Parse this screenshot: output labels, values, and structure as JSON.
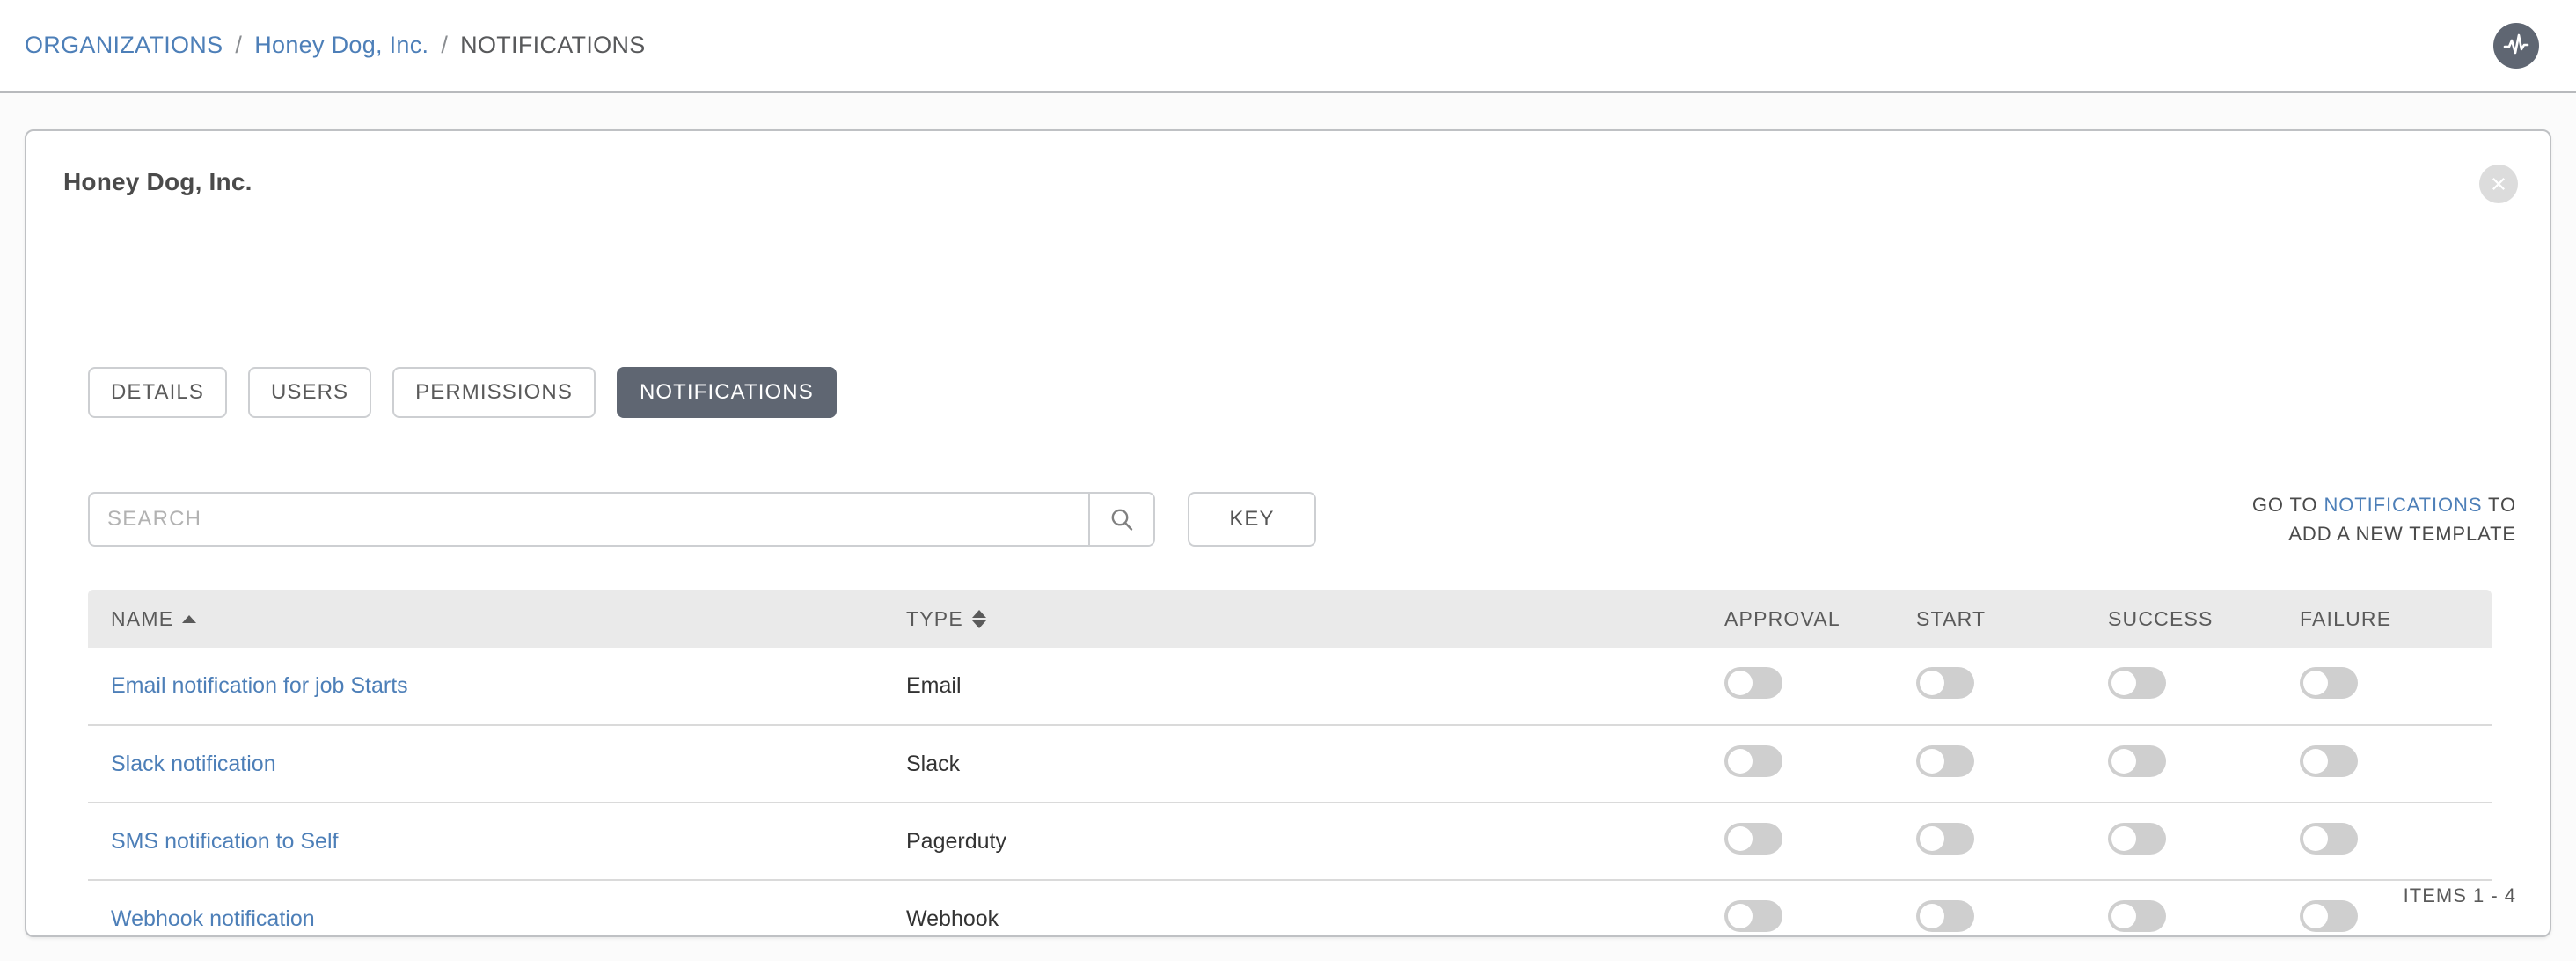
{
  "breadcrumb": {
    "organizations": "ORGANIZATIONS",
    "sep1": "/",
    "org": "Honey Dog, Inc.",
    "sep2": "/",
    "current": "NOTIFICATIONS",
    "activity_icon": "activity-stream-icon"
  },
  "card": {
    "title": "Honey Dog, Inc.",
    "close_icon": "close-circle-icon"
  },
  "tabs": [
    {
      "label": "DETAILS",
      "active": false
    },
    {
      "label": "USERS",
      "active": false
    },
    {
      "label": "PERMISSIONS",
      "active": false
    },
    {
      "label": "NOTIFICATIONS",
      "active": true
    }
  ],
  "search": {
    "placeholder": "SEARCH",
    "value": "",
    "icon": "search-icon"
  },
  "key_button": {
    "label": "KEY"
  },
  "hint": {
    "line1_prefix": "GO TO ",
    "link": "NOTIFICATIONS",
    "line1_suffix": " TO",
    "line2": "ADD A NEW TEMPLATE"
  },
  "table": {
    "columns": [
      {
        "label": "NAME",
        "sort": "asc"
      },
      {
        "label": "TYPE",
        "sort": "none"
      },
      {
        "label": "APPROVAL",
        "sort": null
      },
      {
        "label": "START",
        "sort": null
      },
      {
        "label": "SUCCESS",
        "sort": null
      },
      {
        "label": "FAILURE",
        "sort": null
      }
    ],
    "rows": [
      {
        "name": "Email notification for job Starts",
        "type": "Email",
        "approval": false,
        "start": false,
        "success": false,
        "failure": false
      },
      {
        "name": "Slack notification",
        "type": "Slack",
        "approval": false,
        "start": false,
        "success": false,
        "failure": false
      },
      {
        "name": "SMS notification to Self",
        "type": "Pagerduty",
        "approval": false,
        "start": false,
        "success": false,
        "failure": false
      },
      {
        "name": "Webhook notification",
        "type": "Webhook",
        "approval": false,
        "start": false,
        "success": false,
        "failure": false
      }
    ]
  },
  "footer": {
    "items_label": "ITEMS  1 - 4"
  },
  "colors": {
    "link": "#4d7fb8",
    "active_tab_bg": "#5f6672",
    "header_bg": "#eaeaea",
    "toggle_off": "#cfcfcf",
    "toggle_on": "#5cb85c"
  }
}
